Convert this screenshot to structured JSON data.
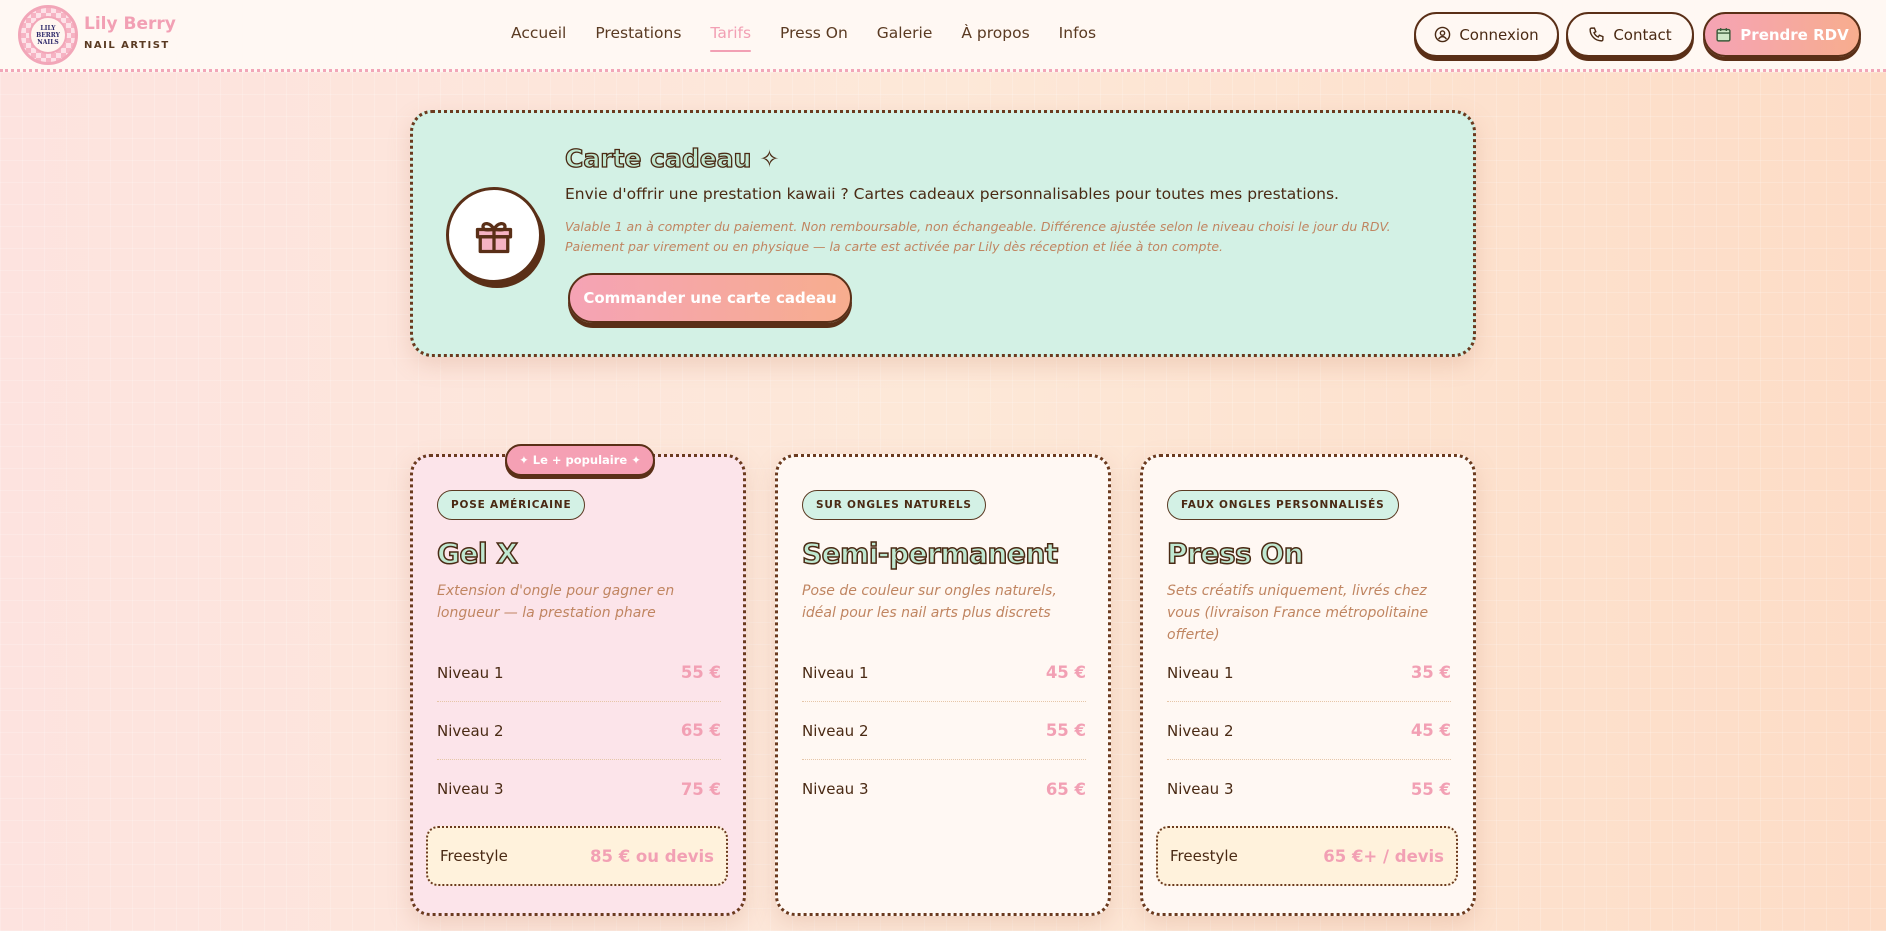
{
  "brand": {
    "name": "Lily Berry",
    "subtitle": "NAIL ARTIST",
    "badge_line1": "LILY",
    "badge_line2": "BERRY",
    "badge_line3": "NAILS"
  },
  "nav": {
    "items": [
      "Accueil",
      "Prestations",
      "Tarifs",
      "Press On",
      "Galerie",
      "À propos",
      "Infos"
    ],
    "active": "Tarifs"
  },
  "header_buttons": {
    "login": "Connexion",
    "contact": "Contact",
    "book": "Prendre RDV"
  },
  "gift_card": {
    "title": "Carte cadeau",
    "sparkle": "✧",
    "description": "Envie d'offrir une prestation kawaii ? Cartes cadeaux personnalisables pour toutes mes prestations.",
    "note": "Valable 1 an à compter du paiement. Non remboursable, non échangeable. Différence ajustée selon le niveau choisi le jour du RDV. Paiement par virement ou en physique — la carte est activée par Lily dès réception et liée à ton compte.",
    "cta": "Commander une carte cadeau"
  },
  "cards": [
    {
      "badge": "✦ Le + populaire ✦",
      "tag": "POSE AMÉRICAINE",
      "name": "Gel X",
      "description": "Extension d'ongle pour gagner en longueur — la prestation phare",
      "rows": [
        {
          "label": "Niveau 1",
          "price": "55 €"
        },
        {
          "label": "Niveau 2",
          "price": "65 €"
        },
        {
          "label": "Niveau 3",
          "price": "75 €"
        }
      ],
      "freestyle": {
        "label": "Freestyle",
        "price": "85 € ou devis"
      }
    },
    {
      "tag": "SUR ONGLES NATURELS",
      "name": "Semi-permanent",
      "description": "Pose de couleur sur ongles naturels, idéal pour les nail arts plus discrets",
      "rows": [
        {
          "label": "Niveau 1",
          "price": "45 €"
        },
        {
          "label": "Niveau 2",
          "price": "55 €"
        },
        {
          "label": "Niveau 3",
          "price": "65 €"
        }
      ]
    },
    {
      "tag": "FAUX ONGLES PERSONNALISÉS",
      "name": "Press On",
      "description": "Sets créatifs uniquement, livrés chez vous (livraison France métropolitaine offerte)",
      "rows": [
        {
          "label": "Niveau 1",
          "price": "35 €"
        },
        {
          "label": "Niveau 2",
          "price": "45 €"
        },
        {
          "label": "Niveau 3",
          "price": "55 €"
        }
      ],
      "freestyle": {
        "label": "Freestyle",
        "price": "65 €+ / devis"
      }
    }
  ],
  "colors": {
    "accent_pink": "#f2a0b4",
    "mint": "#d3f1e5",
    "brown": "#5a2f17"
  }
}
